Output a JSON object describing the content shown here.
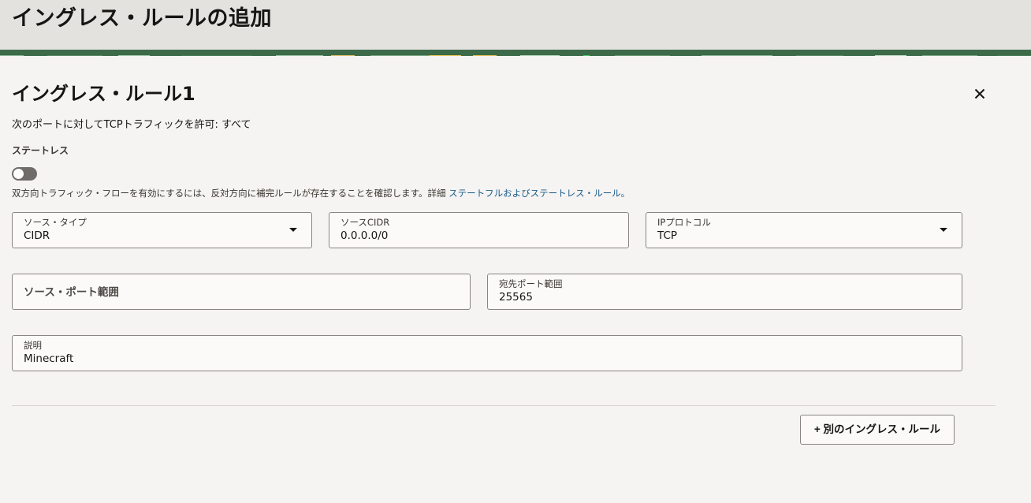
{
  "page": {
    "title": "イングレス・ルールの追加"
  },
  "rule": {
    "title": "イングレス・ルール1",
    "summary": "次のポートに対してTCPトラフィックを許可: すべて",
    "stateless_label": "ステートレス",
    "stateless_enabled": false,
    "help_text": "双方向トラフィック・フローを有効にするには、反対方向に補完ルールが存在することを確認します。詳細",
    "help_link": "ステートフルおよびステートレス・ルール。"
  },
  "fields": {
    "source_type": {
      "label": "ソース・タイプ",
      "value": "CIDR"
    },
    "source_cidr": {
      "label": "ソースCIDR",
      "value": "0.0.0.0/0"
    },
    "ip_protocol": {
      "label": "IPプロトコル",
      "value": "TCP"
    },
    "source_port_range": {
      "placeholder": "ソース・ポート範囲"
    },
    "dest_port_range": {
      "label": "宛先ポート範囲",
      "value": "25565"
    },
    "description": {
      "label": "説明",
      "value": "Minecraft"
    }
  },
  "actions": {
    "add_rule": "+ 別のイングレス・ルール"
  },
  "icons": {
    "close": "close-icon",
    "dropdown": "chevron-down-icon"
  },
  "colors": {
    "header_bg": "#e4e2df",
    "page_bg": "#f5f4f2",
    "link": "#1a5c8a",
    "toggle_off": "#6f6c69"
  }
}
